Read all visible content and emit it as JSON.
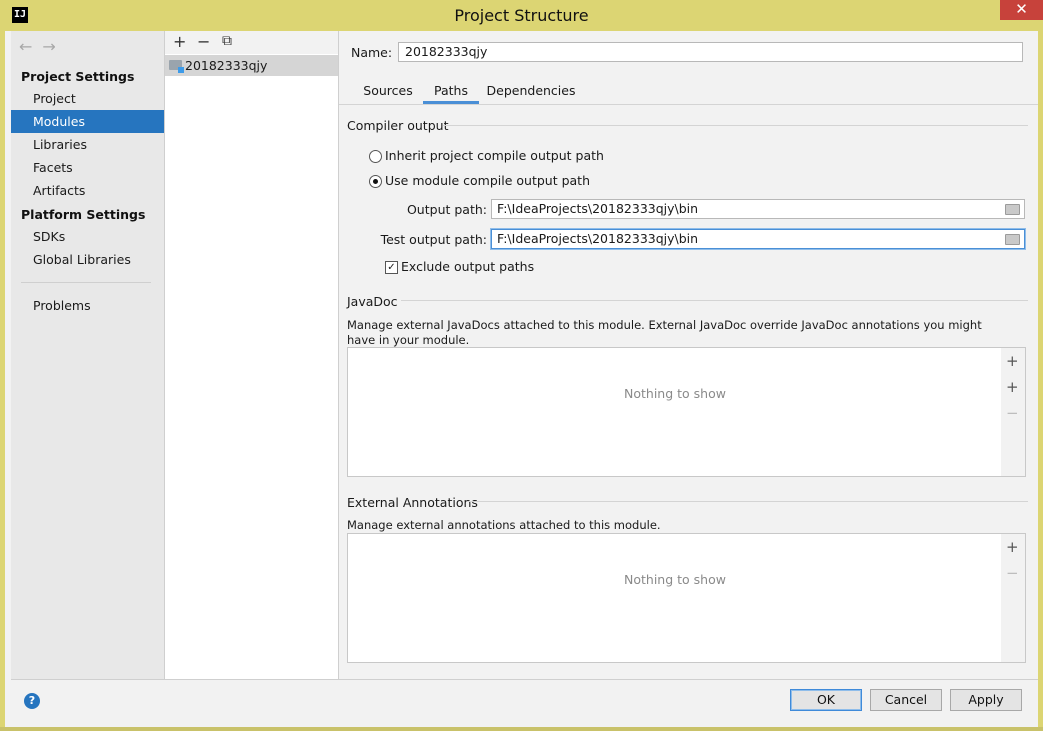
{
  "window": {
    "title": "Project Structure",
    "close_glyph": "✕",
    "logo_text": "IJ"
  },
  "sidebar": {
    "back_glyph": "←",
    "forward_glyph": "→",
    "project_settings_header": "Project Settings",
    "platform_settings_header": "Platform Settings",
    "items": [
      {
        "label": "Project"
      },
      {
        "label": "Modules"
      },
      {
        "label": "Libraries"
      },
      {
        "label": "Facets"
      },
      {
        "label": "Artifacts"
      }
    ],
    "platform_items": [
      {
        "label": "SDKs"
      },
      {
        "label": "Global Libraries"
      }
    ],
    "problems_label": "Problems",
    "selected": "Modules"
  },
  "module_list": {
    "add_glyph": "+",
    "remove_glyph": "−",
    "copy_glyph": "⧉",
    "items": [
      {
        "label": "20182333qjy"
      }
    ]
  },
  "main": {
    "name_label": "Name:",
    "name_value": "20182333qjy",
    "tabs": [
      {
        "label": "Sources"
      },
      {
        "label": "Paths"
      },
      {
        "label": "Dependencies"
      }
    ],
    "active_tab": "Paths",
    "compiler_output": {
      "header": "Compiler output",
      "inherit_label": "Inherit project compile output path",
      "use_module_label": "Use module compile output path",
      "selected_option": "use_module",
      "output_path_label": "Output path:",
      "output_path_value": "F:\\IdeaProjects\\20182333qjy\\bin",
      "test_output_path_label": "Test output path:",
      "test_output_path_value": "F:\\IdeaProjects\\20182333qjy\\bin",
      "exclude_label": "Exclude output paths",
      "exclude_checked": true,
      "check_glyph": "✓"
    },
    "javadoc": {
      "header": "JavaDoc",
      "description": "Manage external JavaDocs attached to this module. External JavaDoc override JavaDoc annotations you might have in your module.",
      "empty_text": "Nothing to show",
      "add_glyph": "+",
      "add_url_glyph": "+",
      "remove_glyph": "−"
    },
    "external_annotations": {
      "header": "External Annotations",
      "description": "Manage external annotations attached to this module.",
      "empty_text": "Nothing to show",
      "add_glyph": "+",
      "remove_glyph": "−"
    }
  },
  "footer": {
    "help_glyph": "?",
    "ok_label": "OK",
    "cancel_label": "Cancel",
    "apply_label": "Apply"
  },
  "colors": {
    "accent": "#2675bf",
    "title_bar": "#dcd573",
    "close_button": "#c7423b"
  }
}
